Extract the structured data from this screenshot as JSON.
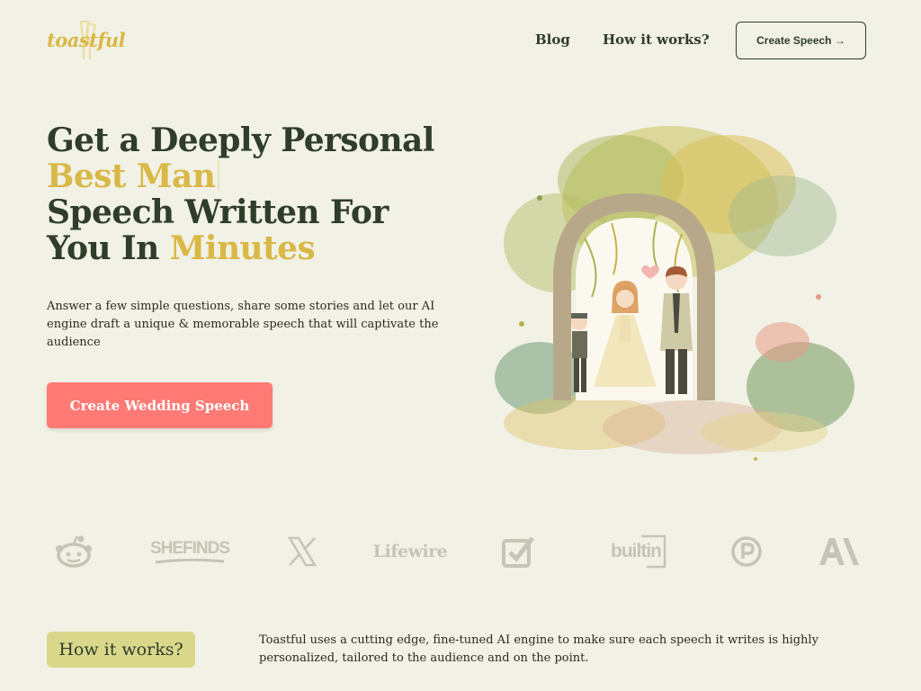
{
  "brand": {
    "logo_text": "toastful"
  },
  "nav": {
    "blog_label": "Blog",
    "how_label": "How it works?",
    "cta_label": "Create Speech →"
  },
  "hero": {
    "title_line1": "Get a Deeply Personal",
    "title_accent": "Best Man",
    "title_line3": "Speech Written For",
    "title_line4_start": "You In ",
    "title_line4_accent": "Minutes",
    "description": "Answer a few simple questions, share some stories and let our AI engine draft a unique & memorable speech that will captivate the audience",
    "cta_label": "Create Wedding Speech",
    "illustration": "watercolor-wedding-couple-under-arch"
  },
  "press_logos": {
    "items": [
      {
        "name": "reddit-icon"
      },
      {
        "name": "shefinds-logo",
        "text": "SHEFINDS"
      },
      {
        "name": "x-icon"
      },
      {
        "name": "lifewire-logo",
        "text": "Lifewire"
      },
      {
        "name": "checkbox-icon"
      },
      {
        "name": "builtin-logo",
        "text": "builtin"
      },
      {
        "name": "producthunt-icon"
      },
      {
        "name": "anthropic-icon"
      }
    ]
  },
  "how_it_works": {
    "label": "How it works?",
    "description": "Toastful uses a cutting edge, fine-tuned AI engine to make sure each speech it writes is highly personalized, tailored to the audience and on the point."
  },
  "colors": {
    "background": "#f1f1e6",
    "text_dark": "#2f3d2a",
    "accent_gold": "#d9b846",
    "cta_coral": "#ff7a74",
    "pill_olive": "#d9d88a",
    "logo_gray": "#c4c5b6"
  }
}
